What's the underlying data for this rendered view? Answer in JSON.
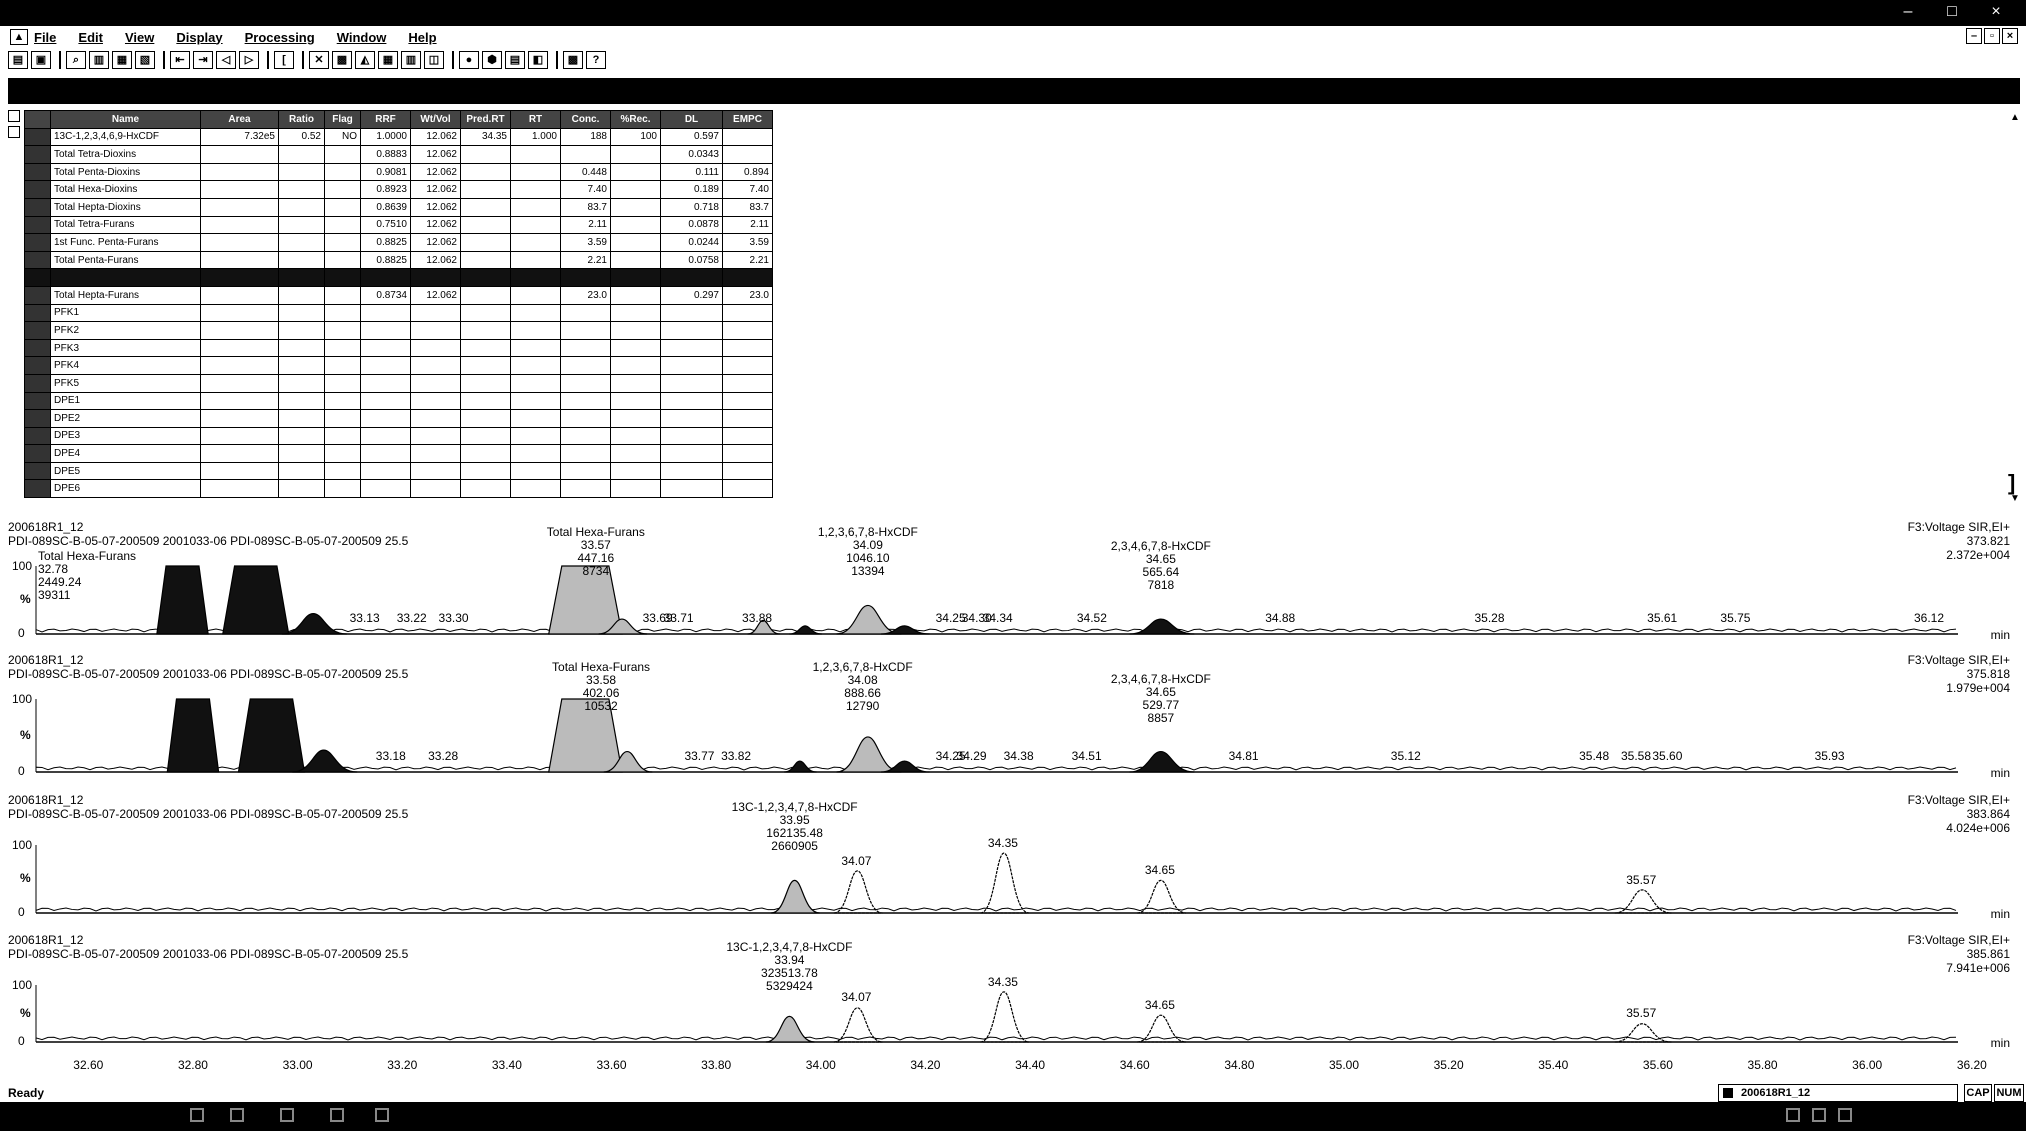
{
  "window": {
    "minimize": "–",
    "maximize": "□",
    "close": "×"
  },
  "menu": {
    "items": [
      "File",
      "Edit",
      "View",
      "Display",
      "Processing",
      "Window",
      "Help"
    ]
  },
  "mdi_controls": [
    "–",
    "▫",
    "×"
  ],
  "toolbar": {
    "icons": [
      "open-icon",
      "save-icon",
      "zoom-icon",
      "print-icon",
      "copy-icon",
      "copy-chrom-icon",
      "peak-left-icon",
      "peak-right-icon",
      "arrow-left-icon",
      "arrow-right-icon",
      "bracket-icon",
      "delete-icon",
      "display-icon",
      "chrom-icon",
      "spectrum-icon",
      "table-icon",
      "book-icon",
      "circle-icon",
      "settings-icon",
      "list-icon",
      "window-icon",
      "printer-icon",
      "help-icon"
    ]
  },
  "table": {
    "headers": [
      "Name",
      "Area",
      "Ratio",
      "Flag",
      "RRF",
      "Wt/Vol",
      "Pred.RT",
      "RT",
      "Conc.",
      "%Rec.",
      "DL",
      "EMPC"
    ],
    "rows": [
      [
        "13C-1,2,3,4,6,9-HxCDF",
        "7.32e5",
        "0.52",
        "NO",
        "1.0000",
        "12.062",
        "34.35",
        "1.000",
        "188",
        "100",
        "0.597",
        ""
      ],
      [
        "Total Tetra-Dioxins",
        "",
        "",
        "",
        "0.8883",
        "12.062",
        "",
        "",
        "",
        "",
        "0.0343",
        ""
      ],
      [
        "Total Penta-Dioxins",
        "",
        "",
        "",
        "0.9081",
        "12.062",
        "",
        "",
        "0.448",
        "",
        "0.111",
        "0.894"
      ],
      [
        "Total Hexa-Dioxins",
        "",
        "",
        "",
        "0.8923",
        "12.062",
        "",
        "",
        "7.40",
        "",
        "0.189",
        "7.40"
      ],
      [
        "Total Hepta-Dioxins",
        "",
        "",
        "",
        "0.8639",
        "12.062",
        "",
        "",
        "83.7",
        "",
        "0.718",
        "83.7"
      ],
      [
        "Total Tetra-Furans",
        "",
        "",
        "",
        "0.7510",
        "12.062",
        "",
        "",
        "2.11",
        "",
        "0.0878",
        "2.11"
      ],
      [
        "1st Func. Penta-Furans",
        "",
        "",
        "",
        "0.8825",
        "12.062",
        "",
        "",
        "3.59",
        "",
        "0.0244",
        "3.59"
      ],
      [
        "Total Penta-Furans",
        "",
        "",
        "",
        "0.8825",
        "12.062",
        "",
        "",
        "2.21",
        "",
        "0.0758",
        "2.21"
      ],
      [
        "",
        "",
        "",
        "",
        "",
        "",
        "",
        "",
        "",
        "",
        "",
        ""
      ],
      [
        "Total Hepta-Furans",
        "",
        "",
        "",
        "0.8734",
        "12.062",
        "",
        "",
        "23.0",
        "",
        "0.297",
        "23.0"
      ],
      [
        "PFK1",
        "",
        "",
        "",
        "",
        "",
        "",
        "",
        "",
        "",
        "",
        ""
      ],
      [
        "PFK2",
        "",
        "",
        "",
        "",
        "",
        "",
        "",
        "",
        "",
        "",
        ""
      ],
      [
        "PFK3",
        "",
        "",
        "",
        "",
        "",
        "",
        "",
        "",
        "",
        "",
        ""
      ],
      [
        "PFK4",
        "",
        "",
        "",
        "",
        "",
        "",
        "",
        "",
        "",
        "",
        ""
      ],
      [
        "PFK5",
        "",
        "",
        "",
        "",
        "",
        "",
        "",
        "",
        "",
        "",
        ""
      ],
      [
        "DPE1",
        "",
        "",
        "",
        "",
        "",
        "",
        "",
        "",
        "",
        "",
        ""
      ],
      [
        "DPE2",
        "",
        "",
        "",
        "",
        "",
        "",
        "",
        "",
        "",
        "",
        ""
      ],
      [
        "DPE3",
        "",
        "",
        "",
        "",
        "",
        "",
        "",
        "",
        "",
        "",
        ""
      ],
      [
        "DPE4",
        "",
        "",
        "",
        "",
        "",
        "",
        "",
        "",
        "",
        "",
        ""
      ],
      [
        "DPE5",
        "",
        "",
        "",
        "",
        "",
        "",
        "",
        "",
        "",
        "",
        ""
      ],
      [
        "DPE6",
        "",
        "",
        "",
        "",
        "",
        "",
        "",
        "",
        "",
        "",
        ""
      ]
    ]
  },
  "axis": {
    "xmin": 32.5,
    "xmax": 36.25,
    "ticks": [
      "32.60",
      "32.80",
      "33.00",
      "33.20",
      "33.40",
      "33.60",
      "33.80",
      "34.00",
      "34.20",
      "34.40",
      "34.60",
      "34.80",
      "35.00",
      "35.20",
      "35.40",
      "35.60",
      "35.80",
      "36.00",
      "36.20"
    ],
    "tick_values": [
      32.6,
      32.8,
      33.0,
      33.2,
      33.4,
      33.6,
      33.8,
      34.0,
      34.2,
      34.4,
      34.6,
      34.8,
      35.0,
      35.2,
      35.4,
      35.6,
      35.8,
      36.0,
      36.2
    ],
    "y100": "100",
    "ypct": "%",
    "y0": "0",
    "unit": "min"
  },
  "traces": [
    {
      "file": "200618R1_12",
      "sample": "PDI-089SC-B-05-07-200509 2001033-06 PDI-089SC-B-05-07-200509 25.5",
      "function": "F3:Voltage SIR,EI+",
      "mass": "373.821",
      "intensity": "2.372e+004",
      "peak_labels": [
        {
          "x": 32.78,
          "lines": [
            "Total Hexa-Furans",
            "32.78",
            "2449.24",
            "39311"
          ]
        },
        {
          "x": 33.57,
          "lines": [
            "Total Hexa-Furans",
            "33.57",
            "447.16",
            "8734"
          ]
        },
        {
          "x": 34.09,
          "lines": [
            "1,2,3,6,7,8-HxCDF",
            "34.09",
            "1046.10",
            "13394"
          ]
        },
        {
          "x": 34.65,
          "lines": [
            "2,3,4,6,7,8-HxCDF",
            "34.65",
            "565.64",
            "7818"
          ]
        }
      ],
      "rt_labels": [
        [
          "33.13",
          33.13
        ],
        [
          "33.22",
          33.22
        ],
        [
          "33.30",
          33.3
        ],
        [
          "33.69",
          33.69
        ],
        [
          "33.71",
          33.73
        ],
        [
          "33.88",
          33.88
        ],
        [
          "34.25",
          34.25
        ],
        [
          "34.30",
          34.3
        ],
        [
          "34.34",
          34.34
        ],
        [
          "34.52",
          34.52
        ],
        [
          "34.88",
          34.88
        ],
        [
          "35.28",
          35.28
        ],
        [
          "35.61",
          35.61
        ],
        [
          "35.75",
          35.75
        ],
        [
          "36.12",
          36.12
        ]
      ]
    },
    {
      "file": "200618R1_12",
      "sample": "PDI-089SC-B-05-07-200509 2001033-06 PDI-089SC-B-05-07-200509 25.5",
      "function": "F3:Voltage SIR,EI+",
      "mass": "375.818",
      "intensity": "1.979e+004",
      "peak_labels": [
        {
          "x": 33.58,
          "lines": [
            "Total Hexa-Furans",
            "33.58",
            "402.06",
            "10532"
          ]
        },
        {
          "x": 34.08,
          "lines": [
            "1,2,3,6,7,8-HxCDF",
            "34.08",
            "888.66",
            "12790"
          ]
        },
        {
          "x": 34.65,
          "lines": [
            "2,3,4,6,7,8-HxCDF",
            "34.65",
            "529.77",
            "8857"
          ]
        }
      ],
      "rt_labels": [
        [
          "33.18",
          33.18
        ],
        [
          "33.28",
          33.28
        ],
        [
          "33.77",
          33.77
        ],
        [
          "33.82",
          33.84
        ],
        [
          "34.25",
          34.25
        ],
        [
          "34.29",
          34.29
        ],
        [
          "34.38",
          34.38
        ],
        [
          "34.51",
          34.51
        ],
        [
          "34.81",
          34.81
        ],
        [
          "35.12",
          35.12
        ],
        [
          "35.48",
          35.48
        ],
        [
          "35.58",
          35.56
        ],
        [
          "35.60",
          35.62
        ],
        [
          "35.93",
          35.93
        ]
      ]
    },
    {
      "file": "200618R1_12",
      "sample": "PDI-089SC-B-05-07-200509 2001033-06 PDI-089SC-B-05-07-200509 25.5",
      "function": "F3:Voltage SIR,EI+",
      "mass": "383.864",
      "intensity": "4.024e+006",
      "peak_labels": [
        {
          "x": 33.95,
          "lines": [
            "13C-1,2,3,4,7,8-HxCDF",
            "33.95",
            "162135.48",
            "2660905"
          ]
        }
      ],
      "rt_labels": [
        [
          "34.07",
          34.07
        ],
        [
          "34.35",
          34.35
        ],
        [
          "34.65",
          34.65
        ],
        [
          "35.57",
          35.57
        ]
      ]
    },
    {
      "file": "200618R1_12",
      "sample": "PDI-089SC-B-05-07-200509 2001033-06 PDI-089SC-B-05-07-200509 25.5",
      "function": "F3:Voltage SIR,EI+",
      "mass": "385.861",
      "intensity": "7.941e+006",
      "peak_labels": [
        {
          "x": 33.94,
          "lines": [
            "13C-1,2,3,4,7,8-HxCDF",
            "33.94",
            "323513.78",
            "5329424"
          ]
        }
      ],
      "rt_labels": [
        [
          "34.07",
          34.07
        ],
        [
          "34.35",
          34.35
        ],
        [
          "34.65",
          34.65
        ],
        [
          "35.57",
          35.57
        ]
      ]
    }
  ],
  "status": {
    "ready": "Ready",
    "file": "200618R1_12",
    "cap": "CAP",
    "num": "NUM"
  }
}
